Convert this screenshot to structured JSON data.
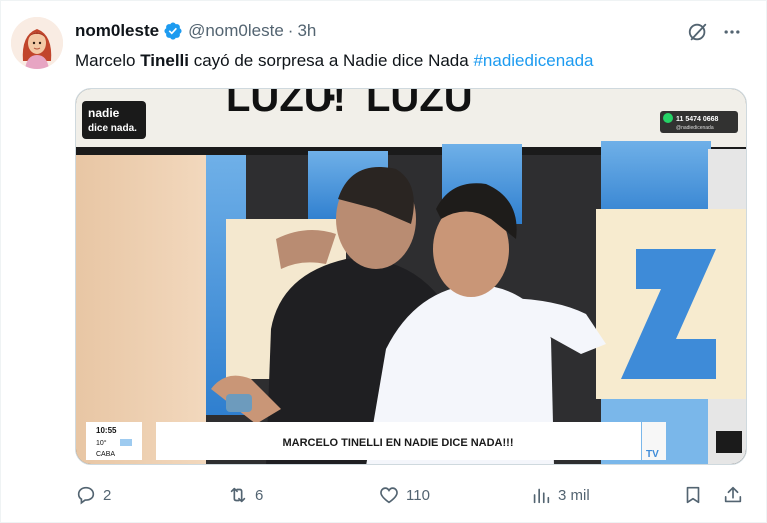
{
  "author": {
    "display_name": "nom0leste",
    "handle": "@nom0leste",
    "separator": "·",
    "time": "3h"
  },
  "tweet": {
    "text_before": "Marcelo ",
    "text_bold": "Tinelli",
    "text_after": " cayó de sorpresa a Nadie dice Nada ",
    "hashtag": "#nadiedicenada"
  },
  "media": {
    "logo_line1": "nadie",
    "logo_line2": "dice nada.",
    "phone": "11 5474 0668",
    "phone_sub": "@nadiedicenada",
    "clock": "10:55",
    "temp": "10°",
    "city": "CABA",
    "lower_third": "MARCELO TINELLI EN NADIE DICE NADA!!!",
    "tv_badge": "TV"
  },
  "actions": {
    "replies": "2",
    "reposts": "6",
    "likes": "110",
    "views": "3 mil"
  },
  "colors": {
    "hashtag": "#1d9bf0",
    "muted": "#536471",
    "verified": "#1d9bf0"
  }
}
